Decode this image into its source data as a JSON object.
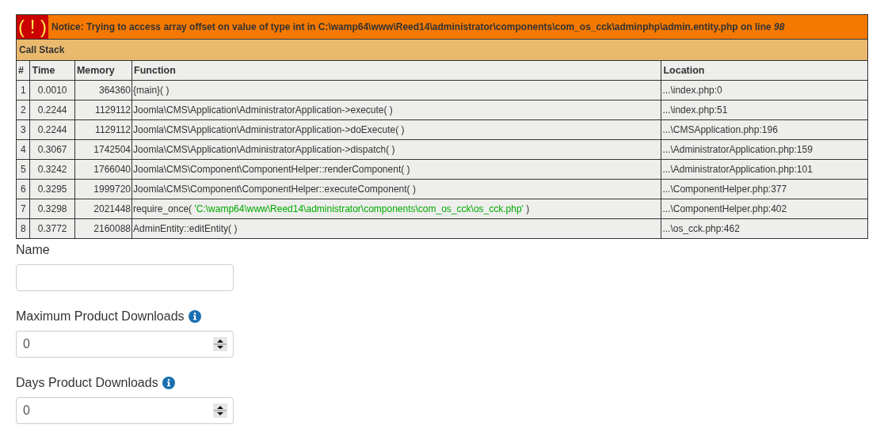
{
  "notice": {
    "icon_text": "( ! )",
    "message": "Notice: Trying to access array offset on value of type int in C:\\wamp64\\www\\Reed14\\administrator\\components\\com_os_cck\\adminphp\\admin.entity.php on line *98*"
  },
  "call_stack": {
    "title": "Call Stack",
    "columns": [
      "#",
      "Time",
      "Memory",
      "Function",
      "Location"
    ],
    "rows": [
      {
        "index": "1",
        "time": "0.0010",
        "memory": "364360",
        "function": "{main}( )",
        "location": "...\\index.php:0"
      },
      {
        "index": "2",
        "time": "0.2244",
        "memory": "1129112",
        "function": "Joomla\\CMS\\Application\\AdministratorApplication->execute( )",
        "location": "...\\index.php:51"
      },
      {
        "index": "3",
        "time": "0.2244",
        "memory": "1129112",
        "function": "Joomla\\CMS\\Application\\AdministratorApplication->doExecute( )",
        "location": "...\\CMSApplication.php:196"
      },
      {
        "index": "4",
        "time": "0.3067",
        "memory": "1742504",
        "function": "Joomla\\CMS\\Application\\AdministratorApplication->dispatch( )",
        "location": "...\\AdministratorApplication.php:159"
      },
      {
        "index": "5",
        "time": "0.3242",
        "memory": "1766040",
        "function": "Joomla\\CMS\\Component\\ComponentHelper::renderComponent( )",
        "location": "...\\AdministratorApplication.php:101"
      },
      {
        "index": "6",
        "time": "0.3295",
        "memory": "1999720",
        "function": "Joomla\\CMS\\Component\\ComponentHelper::executeComponent( )",
        "location": "...\\ComponentHelper.php:377"
      },
      {
        "index": "7",
        "time": "0.3298",
        "memory": "2021448",
        "function": "require_once(",
        "argument": "'C:\\wamp64\\www\\Reed14\\administrator\\components\\com_os_cck\\os_cck.php'",
        "function_end": ")",
        "location": "...\\ComponentHelper.php:402"
      },
      {
        "index": "8",
        "time": "0.3772",
        "memory": "2160088",
        "function": "AdminEntity::editEntity( )",
        "location": "...\\os_cck.php:462"
      }
    ]
  },
  "form": {
    "fields": [
      {
        "kind": "text",
        "label": "Name",
        "info": false
      },
      {
        "kind": "number",
        "label": "Maximum Product Downloads",
        "info": true,
        "value": "0"
      },
      {
        "kind": "number",
        "label": "Days Product Downloads",
        "info": true,
        "value": "0"
      }
    ]
  }
}
